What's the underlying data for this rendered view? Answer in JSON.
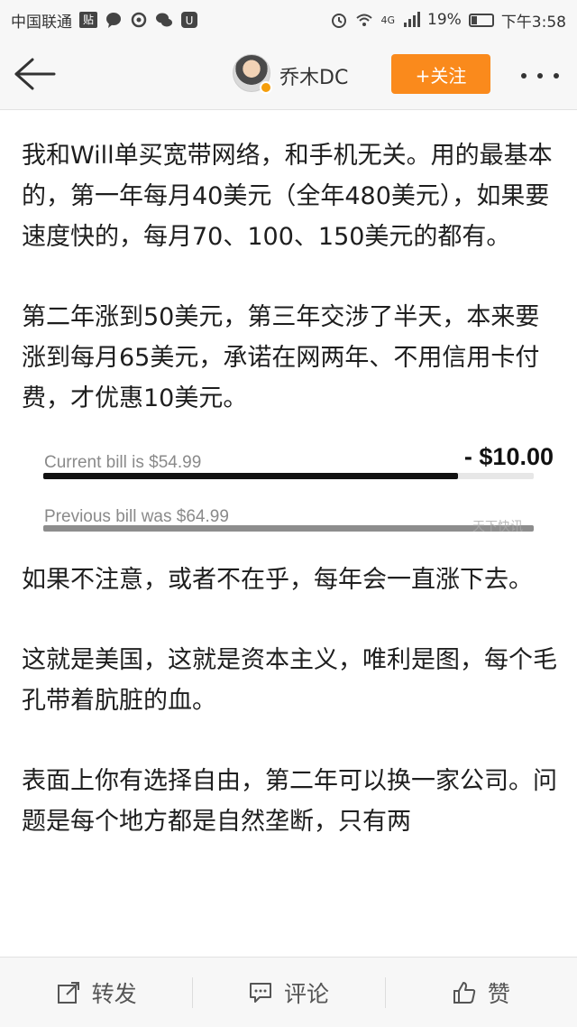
{
  "status_bar": {
    "carrier": "中国联通",
    "app_badge": "贴",
    "network": "4G",
    "battery": "19%",
    "time": "下午3:58"
  },
  "header": {
    "username": "乔木DC",
    "follow_label": "+关注"
  },
  "article": {
    "paragraphs": [
      "我和Will单买宽带网络，和手机无关。用的最基本的，第一年每月40美元（全年480美元），如果要速度快的，每月70、100、150美元的都有。",
      "第二年涨到50美元，第三年交涉了半天，本来要涨到每月65美元，承诺在网两年、不用信用卡付费，才优惠10美元。",
      "如果不注意，或者不在乎，每年会一直涨下去。",
      "这就是美国，这就是资本主义，唯利是图，每个毛孔带着肮脏的血。",
      "表面上你有选择自由，第二年可以换一家公司。问题是每个地方都是自然垄断，只有两"
    ],
    "bill_image": {
      "current_label": "Current bill is $54.99",
      "current_value": 54.99,
      "previous_label": "Previous bill was $64.99",
      "previous_value": 64.99,
      "discount": "- $10.00",
      "watermark": "天下快讯"
    }
  },
  "toolbar": {
    "repost": "转发",
    "comment": "评论",
    "like": "赞"
  }
}
